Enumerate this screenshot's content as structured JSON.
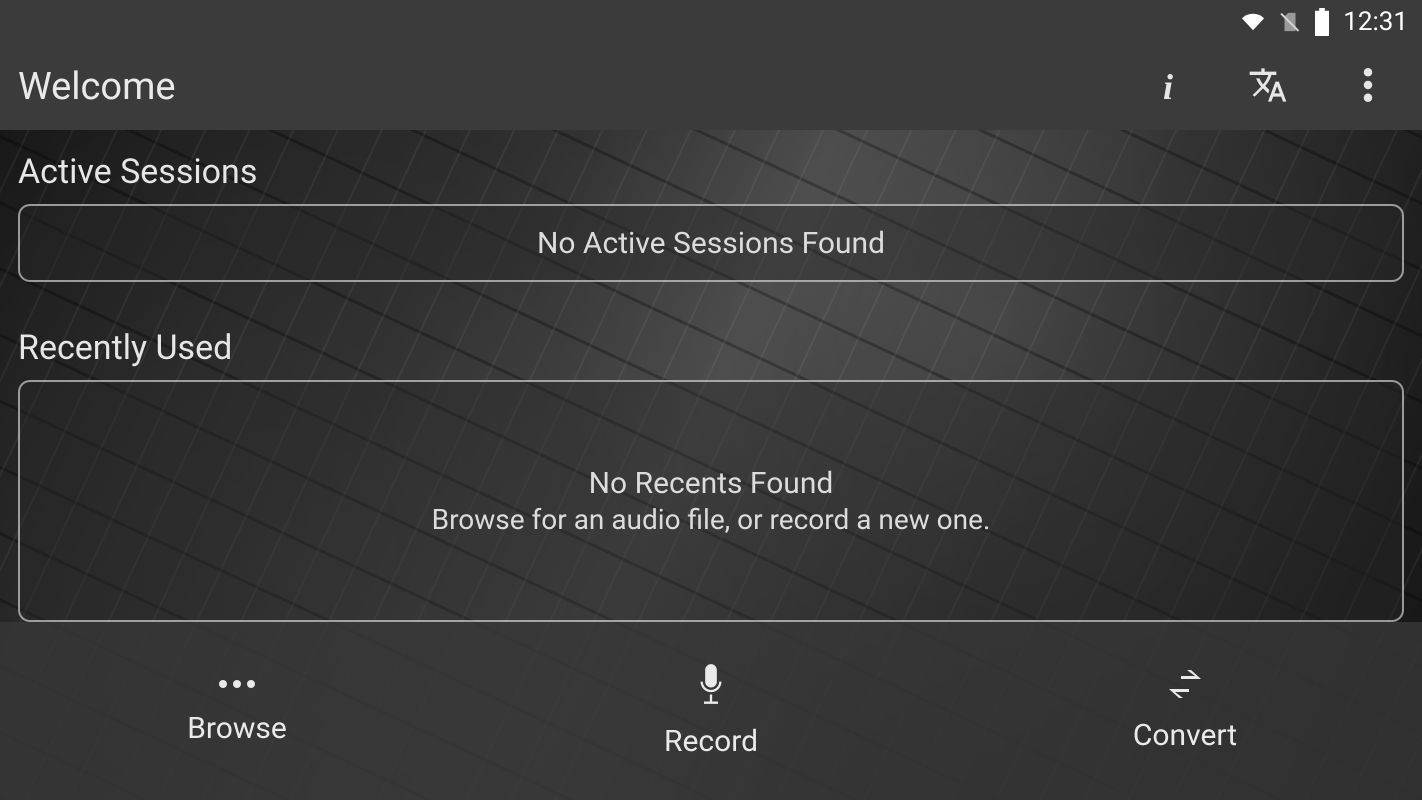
{
  "status": {
    "time": "12:31"
  },
  "appbar": {
    "title": "Welcome"
  },
  "sections": {
    "active": {
      "title": "Active Sessions",
      "empty_primary": "No Active Sessions Found"
    },
    "recent": {
      "title": "Recently Used",
      "empty_primary": "No Recents Found",
      "empty_secondary": "Browse for an audio file, or record a new one."
    }
  },
  "bottom_nav": {
    "browse": "Browse",
    "record": "Record",
    "convert": "Convert"
  }
}
